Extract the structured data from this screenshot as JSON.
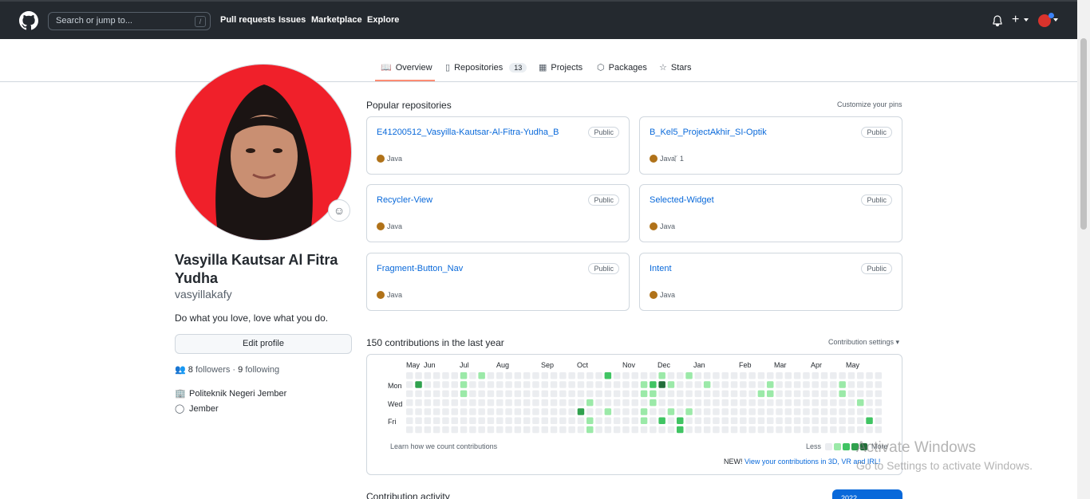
{
  "header": {
    "search_placeholder": "Search or jump to...",
    "search_shortcut": "/",
    "nav": [
      "Pull requests",
      "Issues",
      "Marketplace",
      "Explore"
    ],
    "plus": "+"
  },
  "tabs": {
    "overview": "Overview",
    "repositories": "Repositories",
    "repositories_count": "13",
    "projects": "Projects",
    "packages": "Packages",
    "stars": "Stars"
  },
  "profile": {
    "name": "Vasyilla Kautsar Al Fitra Yudha",
    "login": "vasyillakafy",
    "bio": "Do what you love, love what you do.",
    "edit_button": "Edit profile",
    "followers": "8",
    "followers_label": "followers",
    "separator": "·",
    "following": "9",
    "following_label": "following",
    "organization": "Politeknik Negeri Jember",
    "location": "Jember"
  },
  "pinned": {
    "title": "Popular repositories",
    "customize": "Customize your pins",
    "repos": [
      {
        "name": "E41200512_Vasyilla-Kautsar-Al-Fitra-Yudha_B",
        "visibility": "Public",
        "language": "Java",
        "forks": ""
      },
      {
        "name": "B_Kel5_ProjectAkhir_SI-Optik",
        "visibility": "Public",
        "language": "Java",
        "forks": "1"
      },
      {
        "name": "Recycler-View",
        "visibility": "Public",
        "language": "Java",
        "forks": ""
      },
      {
        "name": "Selected-Widget",
        "visibility": "Public",
        "language": "Java",
        "forks": ""
      },
      {
        "name": "Fragment-Button_Nav",
        "visibility": "Public",
        "language": "Java",
        "forks": ""
      },
      {
        "name": "Intent",
        "visibility": "Public",
        "language": "Java",
        "forks": ""
      }
    ],
    "language_color": "#b07219"
  },
  "contributions": {
    "title": "150 contributions in the last year",
    "settings": "Contribution settings ▾",
    "months": [
      "May",
      "Jun",
      "Jul",
      "Aug",
      "Sep",
      "Oct",
      "Nov",
      "Dec",
      "Jan",
      "Feb",
      "Mar",
      "Apr",
      "May"
    ],
    "weekdays": [
      "Mon",
      "Wed",
      "Fri"
    ],
    "learn": "Learn how we count contributions",
    "less": "Less",
    "more": "More",
    "new_label": "NEW!",
    "new_link": "View your contributions in 3D, VR and IRL!",
    "colors": [
      "#ebedf0",
      "#9be9a8",
      "#40c463",
      "#30a14e",
      "#216e39"
    ]
  },
  "activity": {
    "title": "Contribution activity",
    "year": "2022"
  },
  "watermark": {
    "line1": "Activate Windows",
    "line2": "Go to Settings to activate Windows."
  }
}
